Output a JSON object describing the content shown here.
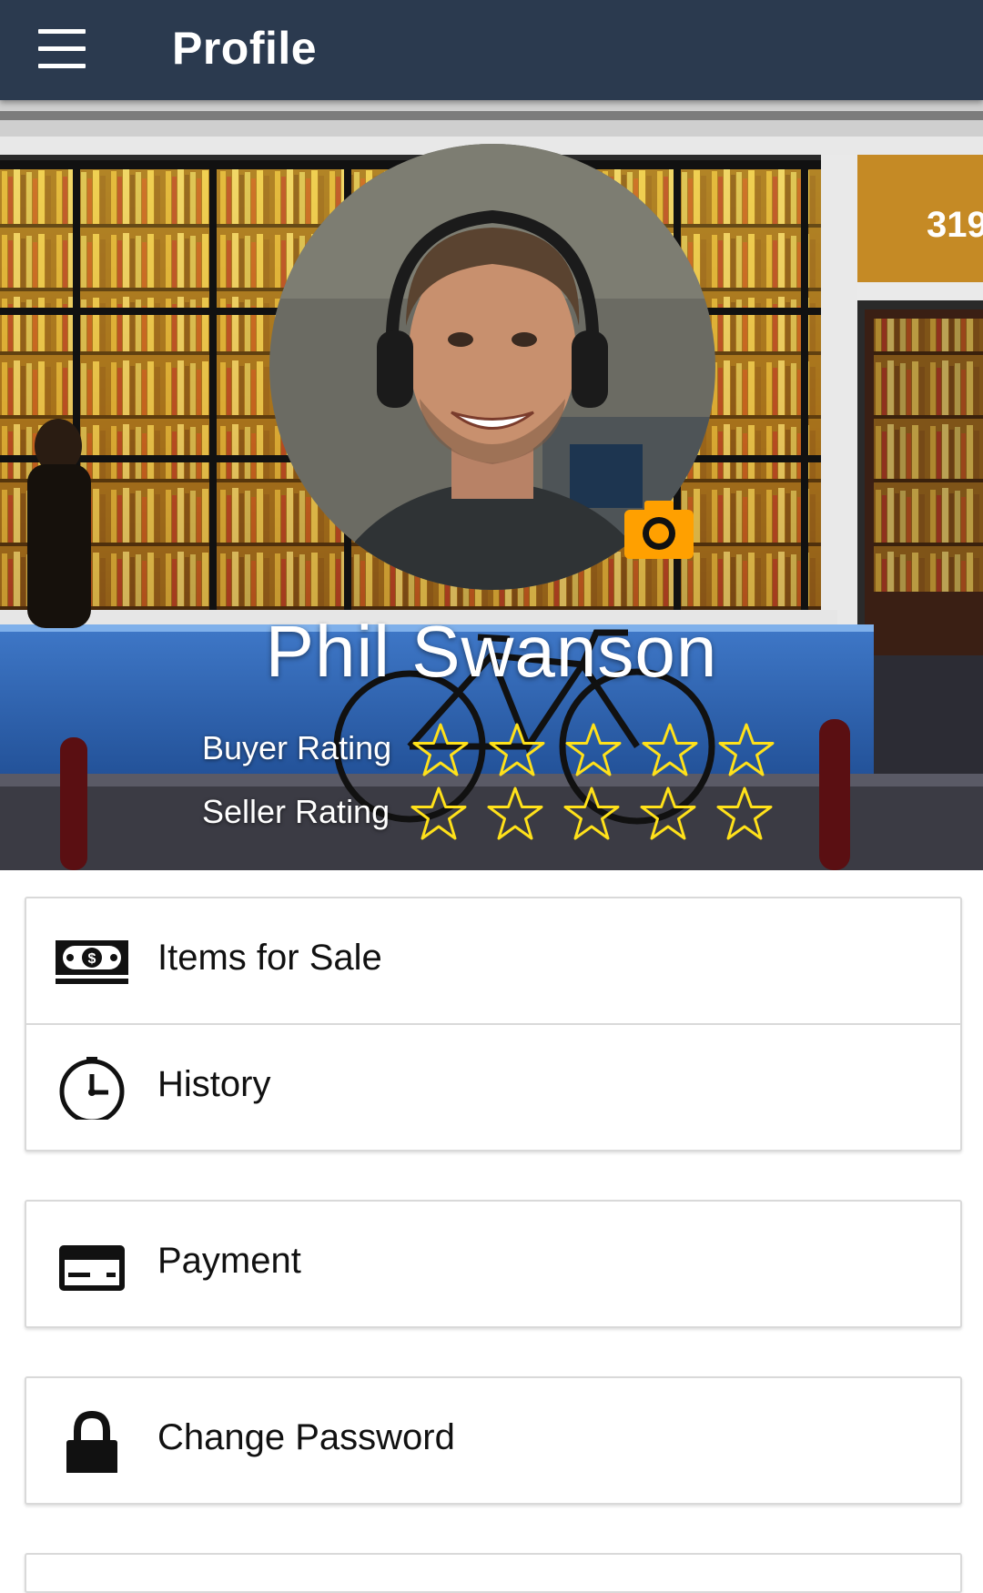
{
  "app_bar": {
    "title": "Profile",
    "menu_icon": "hamburger-menu-icon"
  },
  "profile": {
    "name": "Phil Swanson",
    "camera_icon": "camera-icon",
    "buyer_rating": {
      "label": "Buyer Rating",
      "value": 0,
      "max": 5
    },
    "seller_rating": {
      "label": "Seller Rating",
      "value": 0,
      "max": 5
    }
  },
  "menu": {
    "items_for_sale": {
      "label": "Items for Sale",
      "icon": "money-icon"
    },
    "history": {
      "label": "History",
      "icon": "clock-icon"
    },
    "payment": {
      "label": "Payment",
      "icon": "credit-card-icon"
    },
    "change_password": {
      "label": "Change Password",
      "icon": "lock-icon"
    }
  },
  "colors": {
    "app_bar": "#2b3a4f",
    "star_outline": "#ffe11a",
    "camera_accent": "#ffa000",
    "card_border": "#d9d9d9"
  }
}
